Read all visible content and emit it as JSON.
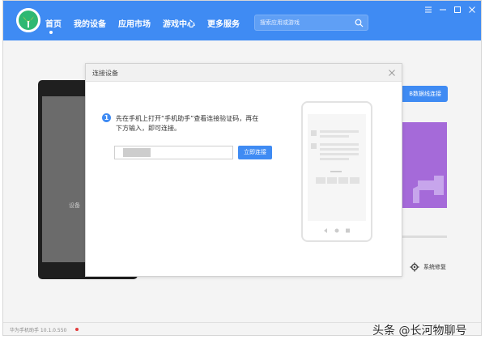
{
  "nav": {
    "items": [
      {
        "label": "首页"
      },
      {
        "label": "我的设备"
      },
      {
        "label": "应用市场"
      },
      {
        "label": "游戏中心"
      },
      {
        "label": "更多服务"
      }
    ]
  },
  "search": {
    "placeholder": "搜索应用或游戏"
  },
  "background": {
    "phone_label": "设备",
    "usb_button_label": "B数据线连接",
    "repair_label": "系统修复"
  },
  "dialog": {
    "title": "连接设备",
    "instruction_line1": "先在手机上打开“手机助手”查看连接验证码，再在",
    "instruction_line2": "下方输入，即可连接。",
    "connect_button": "立即连接"
  },
  "status": {
    "version_text": "华为手机助手 10.1.0.550"
  },
  "watermark": "头条 @长河物聊号",
  "colors": {
    "accent": "#3f8bf3",
    "promo": "#a56ad9",
    "status_dot": "#e23b3b"
  },
  "icons": [
    "app-logo-icon",
    "search-icon",
    "menu-icon",
    "minimize-icon",
    "maximize-icon",
    "close-icon",
    "info-icon",
    "gear-icon",
    "dialog-close-icon"
  ]
}
